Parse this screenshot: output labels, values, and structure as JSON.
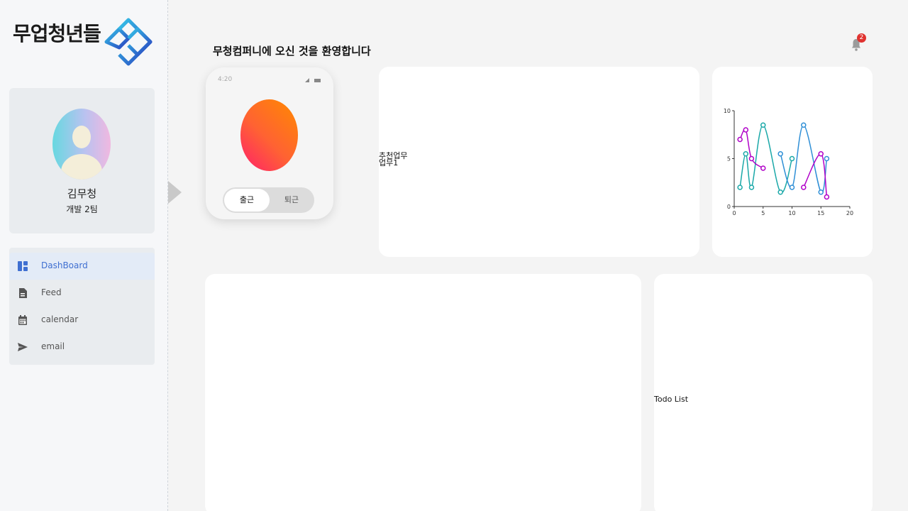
{
  "brand": {
    "name": "무업청년들"
  },
  "profile": {
    "name": "김무청",
    "team": "개발 2팀"
  },
  "nav": {
    "items": [
      {
        "label": "DashBoard",
        "icon": "dashboard-icon"
      },
      {
        "label": "Feed",
        "icon": "document-icon"
      },
      {
        "label": "calendar",
        "icon": "calendar-icon"
      },
      {
        "label": "email",
        "icon": "send-icon"
      }
    ]
  },
  "header": {
    "welcome": "무청컴퍼니에 오신 것을 환영합니다",
    "notification_count": "2"
  },
  "punch": {
    "time": "4:20",
    "check_in": "출근",
    "check_out": "퇴근"
  },
  "recommend": {
    "title": "추천업무",
    "item": "업무1"
  },
  "todo": {
    "title": "Todo List"
  },
  "colors": {
    "accent": "#3f6fd1",
    "teal": "#1aa8a8",
    "blue": "#2f8fd6",
    "magenta": "#b000c8",
    "badge": "#e0322f"
  },
  "chart_data": {
    "type": "line",
    "xlim": [
      0,
      20
    ],
    "ylim": [
      0,
      10
    ],
    "xticks": [
      0,
      5,
      10,
      15,
      20
    ],
    "yticks": [
      0,
      5,
      10
    ],
    "series": [
      {
        "color": "#1aa8a8",
        "points": [
          [
            1,
            2
          ],
          [
            2,
            5.5
          ],
          [
            3,
            2
          ],
          [
            5,
            8.5
          ],
          [
            8,
            1.5
          ],
          [
            10,
            5
          ]
        ]
      },
      {
        "color": "#2f8fd6",
        "points": [
          [
            8,
            5.5
          ],
          [
            10,
            2
          ],
          [
            12,
            8.5
          ],
          [
            15,
            1.5
          ],
          [
            16,
            5
          ]
        ]
      },
      {
        "color": "#b000c8",
        "points": [
          [
            1,
            7
          ],
          [
            2,
            8
          ],
          [
            3,
            5
          ],
          [
            5,
            4
          ]
        ]
      },
      {
        "color": "#b000c8",
        "points": [
          [
            12,
            2
          ],
          [
            15,
            5.5
          ],
          [
            16,
            1
          ]
        ]
      }
    ]
  }
}
